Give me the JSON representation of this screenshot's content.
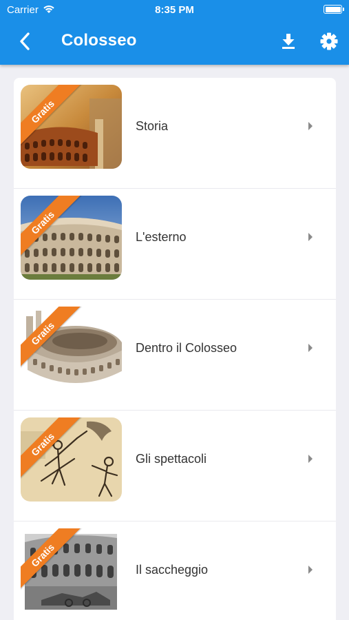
{
  "status_bar": {
    "carrier": "Carrier",
    "time": "8:35 PM"
  },
  "header": {
    "title": "Colosseo",
    "back_icon": "chevron-left-icon",
    "download_icon": "download-icon",
    "settings_icon": "gear-icon"
  },
  "colors": {
    "appbar": "#1a8fe8",
    "ribbon": "#ef7d22",
    "background": "#efeff4"
  },
  "list": {
    "items": [
      {
        "label": "Storia",
        "badge": "Gratis"
      },
      {
        "label": "L'esterno",
        "badge": "Gratis"
      },
      {
        "label": "Dentro il Colosseo",
        "badge": "Gratis"
      },
      {
        "label": "Gli spettacoli",
        "badge": "Gratis"
      },
      {
        "label": "Il saccheggio",
        "badge": "Gratis"
      }
    ]
  }
}
